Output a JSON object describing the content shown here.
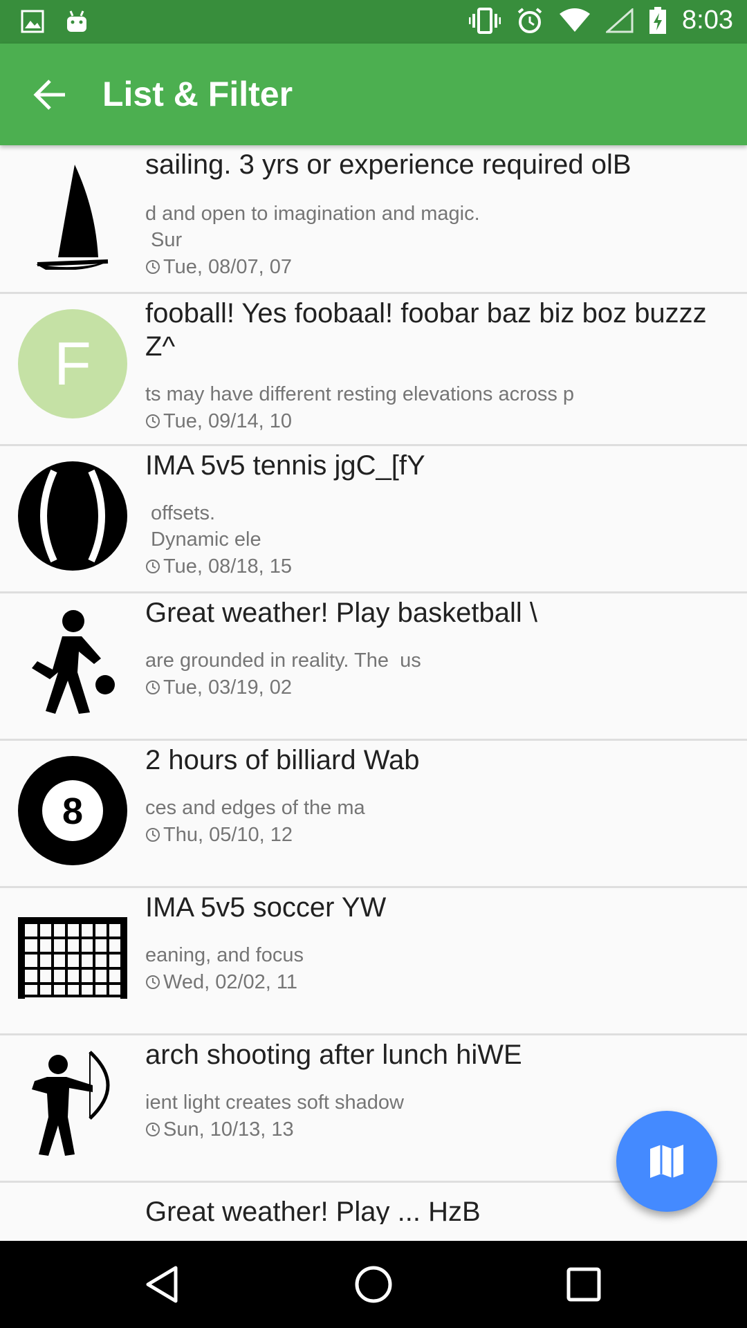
{
  "status_bar": {
    "time": "8:03",
    "icons": [
      "image-icon",
      "android-icon",
      "vibrate-icon",
      "alarm-icon",
      "wifi-icon",
      "signal-icon",
      "battery-charging-icon"
    ]
  },
  "app_bar": {
    "title": "List & Filter",
    "background": "#4caf50"
  },
  "list": {
    "items": [
      {
        "icon": "sailboat-icon",
        "headline": "sailing. 3 yrs or experience required olB",
        "subtext": "d and open to imagination and magic.\n Sur",
        "date": "Tue, 08/07, 07"
      },
      {
        "icon": "letter-avatar",
        "avatar_letter": "F",
        "avatar_color": "#c5e1a5",
        "headline": "fooball! Yes foobaal! foobar baz biz boz buzzz Z^",
        "subtext": "ts may have different resting elevations across p",
        "date": "Tue, 09/14, 10"
      },
      {
        "icon": "tennis-ball-icon",
        "headline": "IMA 5v5 tennis jgC_[fY",
        "subtext": " offsets.\n Dynamic ele",
        "date": "Tue, 08/18, 15"
      },
      {
        "icon": "basketball-player-icon",
        "headline": "Great weather! Play basketball \\",
        "subtext": "are grounded in reality. The  us",
        "date": "Tue, 03/19, 02"
      },
      {
        "icon": "billiard-8-ball-icon",
        "ball_number": "8",
        "headline": "2 hours of billiard Wab",
        "subtext": "ces and edges of the ma",
        "date": "Thu, 05/10, 12"
      },
      {
        "icon": "soccer-goal-icon",
        "headline": "IMA 5v5 soccer YW",
        "subtext": "eaning, and focus",
        "date": "Wed, 02/02, 11"
      },
      {
        "icon": "archer-icon",
        "headline": "arch shooting after lunch hiWE",
        "subtext": "ient light creates soft shadow",
        "date": "Sun, 10/13, 13"
      },
      {
        "icon": "partial-row",
        "headline": "Great weather! Play ... HzB"
      }
    ]
  },
  "fab": {
    "icon": "map-icon",
    "color": "#448aff"
  },
  "nav_bar": {
    "buttons": [
      "back-triangle-icon",
      "home-circle-icon",
      "recents-square-icon"
    ]
  }
}
